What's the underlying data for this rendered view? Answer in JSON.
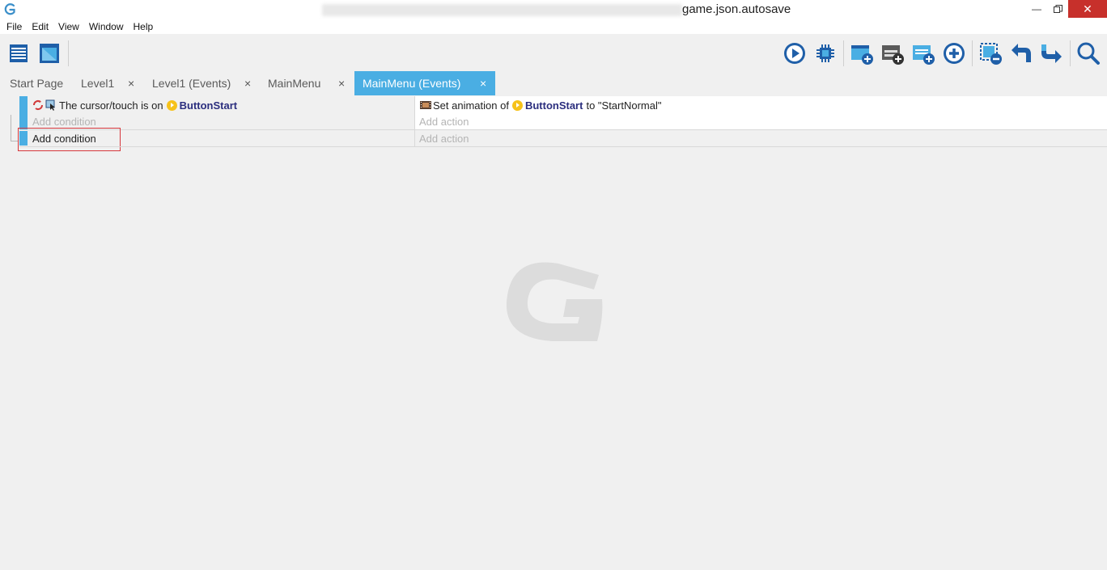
{
  "window": {
    "title": "game.json.autosave",
    "min_icon": "minimize-icon",
    "max_icon": "restore-icon",
    "close_icon": "close-icon"
  },
  "menu": [
    "File",
    "Edit",
    "View",
    "Window",
    "Help"
  ],
  "toolbar": {
    "icons": [
      "project-manager-icon",
      "scene-editor-icon",
      "preview-icon",
      "debugger-icon",
      "add-event-icon",
      "add-subevent-icon",
      "add-condition-icon",
      "add-more-icon",
      "delete-icon",
      "undo-icon",
      "redo-icon",
      "search-icon"
    ]
  },
  "tabs": [
    {
      "label": "Start Page",
      "closable": false,
      "active": false
    },
    {
      "label": "Level1",
      "closable": true,
      "active": false
    },
    {
      "label": "Level1 (Events)",
      "closable": true,
      "active": false
    },
    {
      "label": "MainMenu",
      "closable": true,
      "active": false
    },
    {
      "label": "MainMenu (Events)",
      "closable": true,
      "active": true
    }
  ],
  "tab_close_glyph": "×",
  "event1": {
    "condition_prefix": "The cursor/touch is on",
    "condition_object": "ButtonStart",
    "add_condition": "Add condition",
    "action_prefix": "Set animation of",
    "action_object": "ButtonStart",
    "action_suffix": "to \"StartNormal\"",
    "add_action": "Add action"
  },
  "new_event": {
    "add_condition": "Add condition",
    "add_action": "Add action"
  },
  "colors": {
    "accent": "#4aaee3",
    "highlight_box": "#d6373c",
    "object_name": "#2b2e7e"
  }
}
